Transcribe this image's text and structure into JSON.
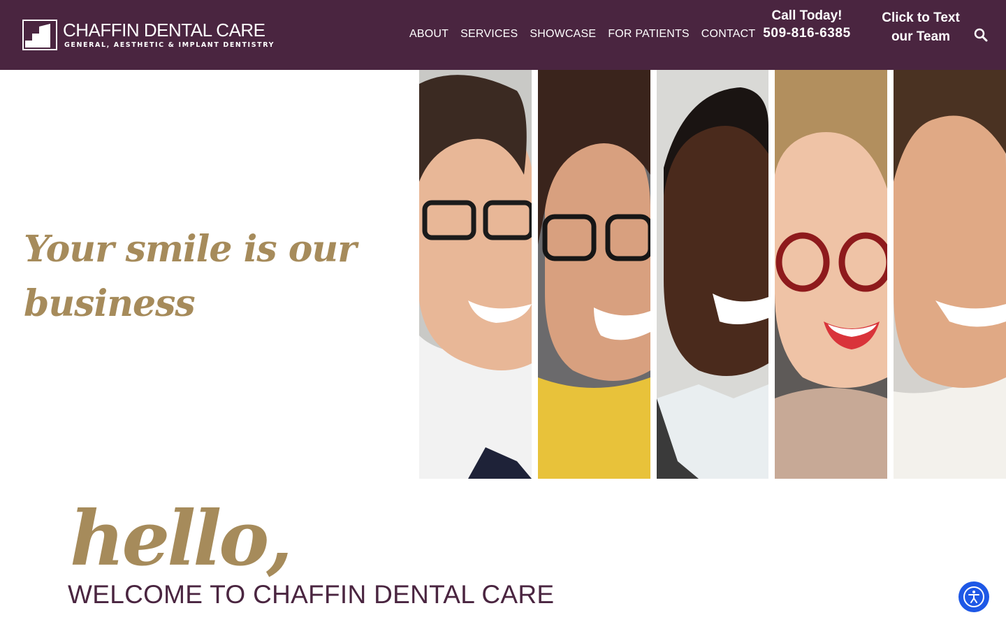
{
  "brand": {
    "name": "CHAFFIN DENTAL CARE",
    "tagline": "GENERAL, AESTHETIC & IMPLANT DENTISTRY",
    "logo_icon": "logo-mark-icon"
  },
  "nav": {
    "items": [
      {
        "label": "ABOUT"
      },
      {
        "label": "SERVICES"
      },
      {
        "label": "SHOWCASE"
      },
      {
        "label": "FOR PATIENTS"
      },
      {
        "label": "CONTACT"
      }
    ]
  },
  "call": {
    "label": "Call Today!",
    "phone": "509-816-6385"
  },
  "text_team": {
    "line1": "Click to Text",
    "line2": "our Team"
  },
  "search": {
    "icon": "search-icon"
  },
  "hero": {
    "tagline": "Your smile is our business"
  },
  "intro": {
    "greeting": "hello,",
    "welcome": "WELCOME TO CHAFFIN DENTAL CARE"
  },
  "accessibility": {
    "icon": "accessibility-icon"
  },
  "colors": {
    "header_bg": "#4a2540",
    "gold": "#a68b5b",
    "plum_text": "#4a2540",
    "accessibility_button": "#1e58e6"
  }
}
